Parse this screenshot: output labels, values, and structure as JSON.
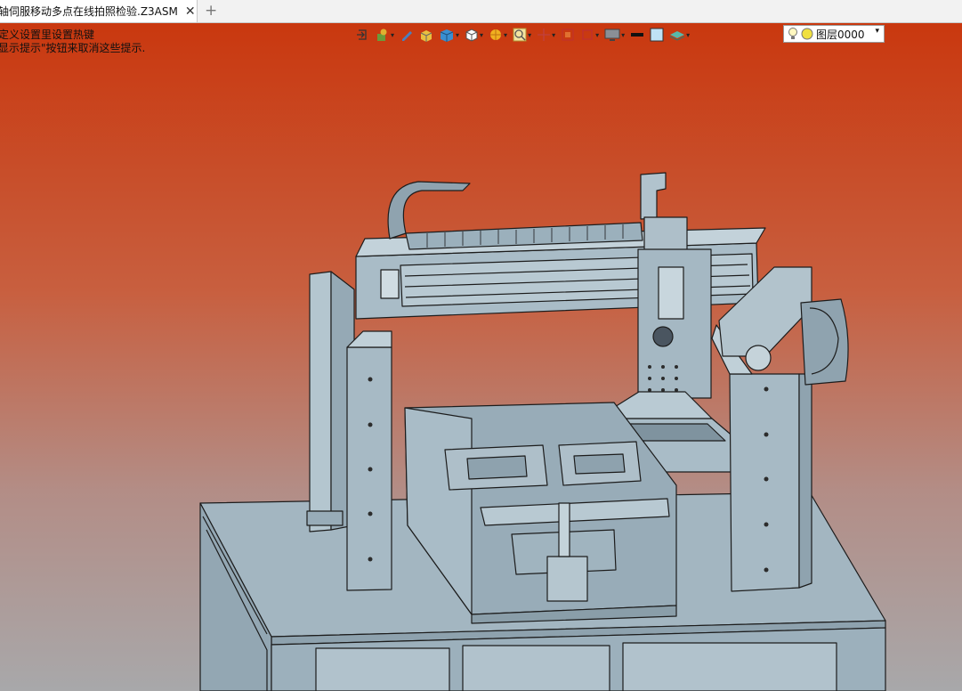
{
  "tab": {
    "title": "轴伺服移动多点在线拍照检验.Z3ASM",
    "close": "✕",
    "add": "+"
  },
  "hints": [
    "定义设置里设置热键",
    "显示提示\"按钮来取消这些提示."
  ],
  "toolbar": {
    "icons": [
      "exit-icon",
      "component-icon",
      "pencil-icon",
      "box-icon",
      "cube-icon",
      "view-cube-icon",
      "render-icon",
      "zoom-icon",
      "pan-icon",
      "section-icon",
      "frame-icon",
      "monitor-icon",
      "line-icon",
      "fill-icon",
      "layer-stack-icon"
    ],
    "layer_value": "图层0000"
  },
  "colors": {
    "bg_top": "#c9380f",
    "bg_bottom": "#a8a8aa",
    "model_fill": "#9fb3bf",
    "model_line": "#1c1c1c"
  }
}
